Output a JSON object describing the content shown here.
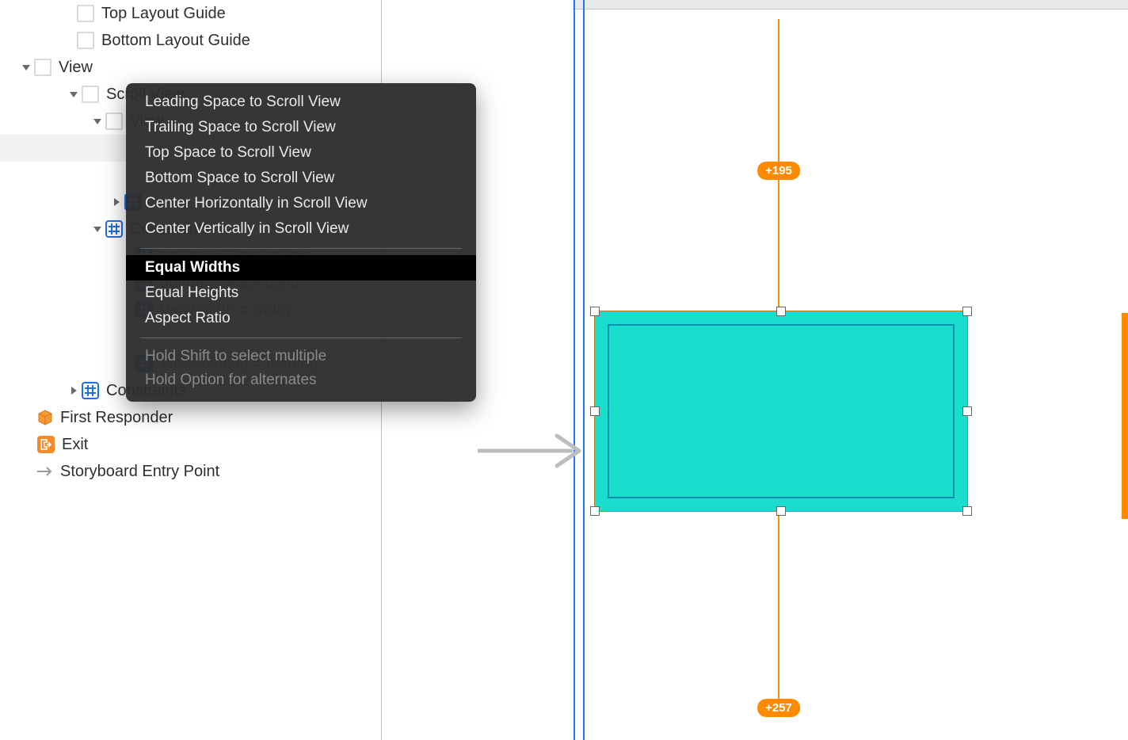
{
  "outline": {
    "top_layout_guide": "Top Layout Guide",
    "bottom_layout_guide": "Bottom Layout Guide",
    "view": "View",
    "scroll_view": "Scroll View",
    "inner_view": "View",
    "constraints_top": "Constraints",
    "c_trailing": "trailing = View.trailing",
    "c_bottom": "bottom = View.bottom",
    "c_width": "View.width = width",
    "c_leading": "View.leading = leading",
    "constraints_bottom": "Constraints",
    "first_responder": "First Responder",
    "exit": "Exit",
    "entry_point": "Storyboard Entry Point"
  },
  "context_menu": {
    "leading": "Leading Space to Scroll View",
    "trailing": "Trailing Space to Scroll View",
    "top": "Top Space to Scroll View",
    "bottom": "Bottom Space to Scroll View",
    "centerH": "Center Horizontally in Scroll View",
    "centerV": "Center Vertically in Scroll View",
    "equalW": "Equal Widths",
    "equalH": "Equal Heights",
    "aspect": "Aspect Ratio",
    "hint1": "Hold Shift to select multiple",
    "hint2": "Hold Option for alternates"
  },
  "canvas": {
    "badge_top": "+195",
    "badge_bottom": "+257"
  }
}
